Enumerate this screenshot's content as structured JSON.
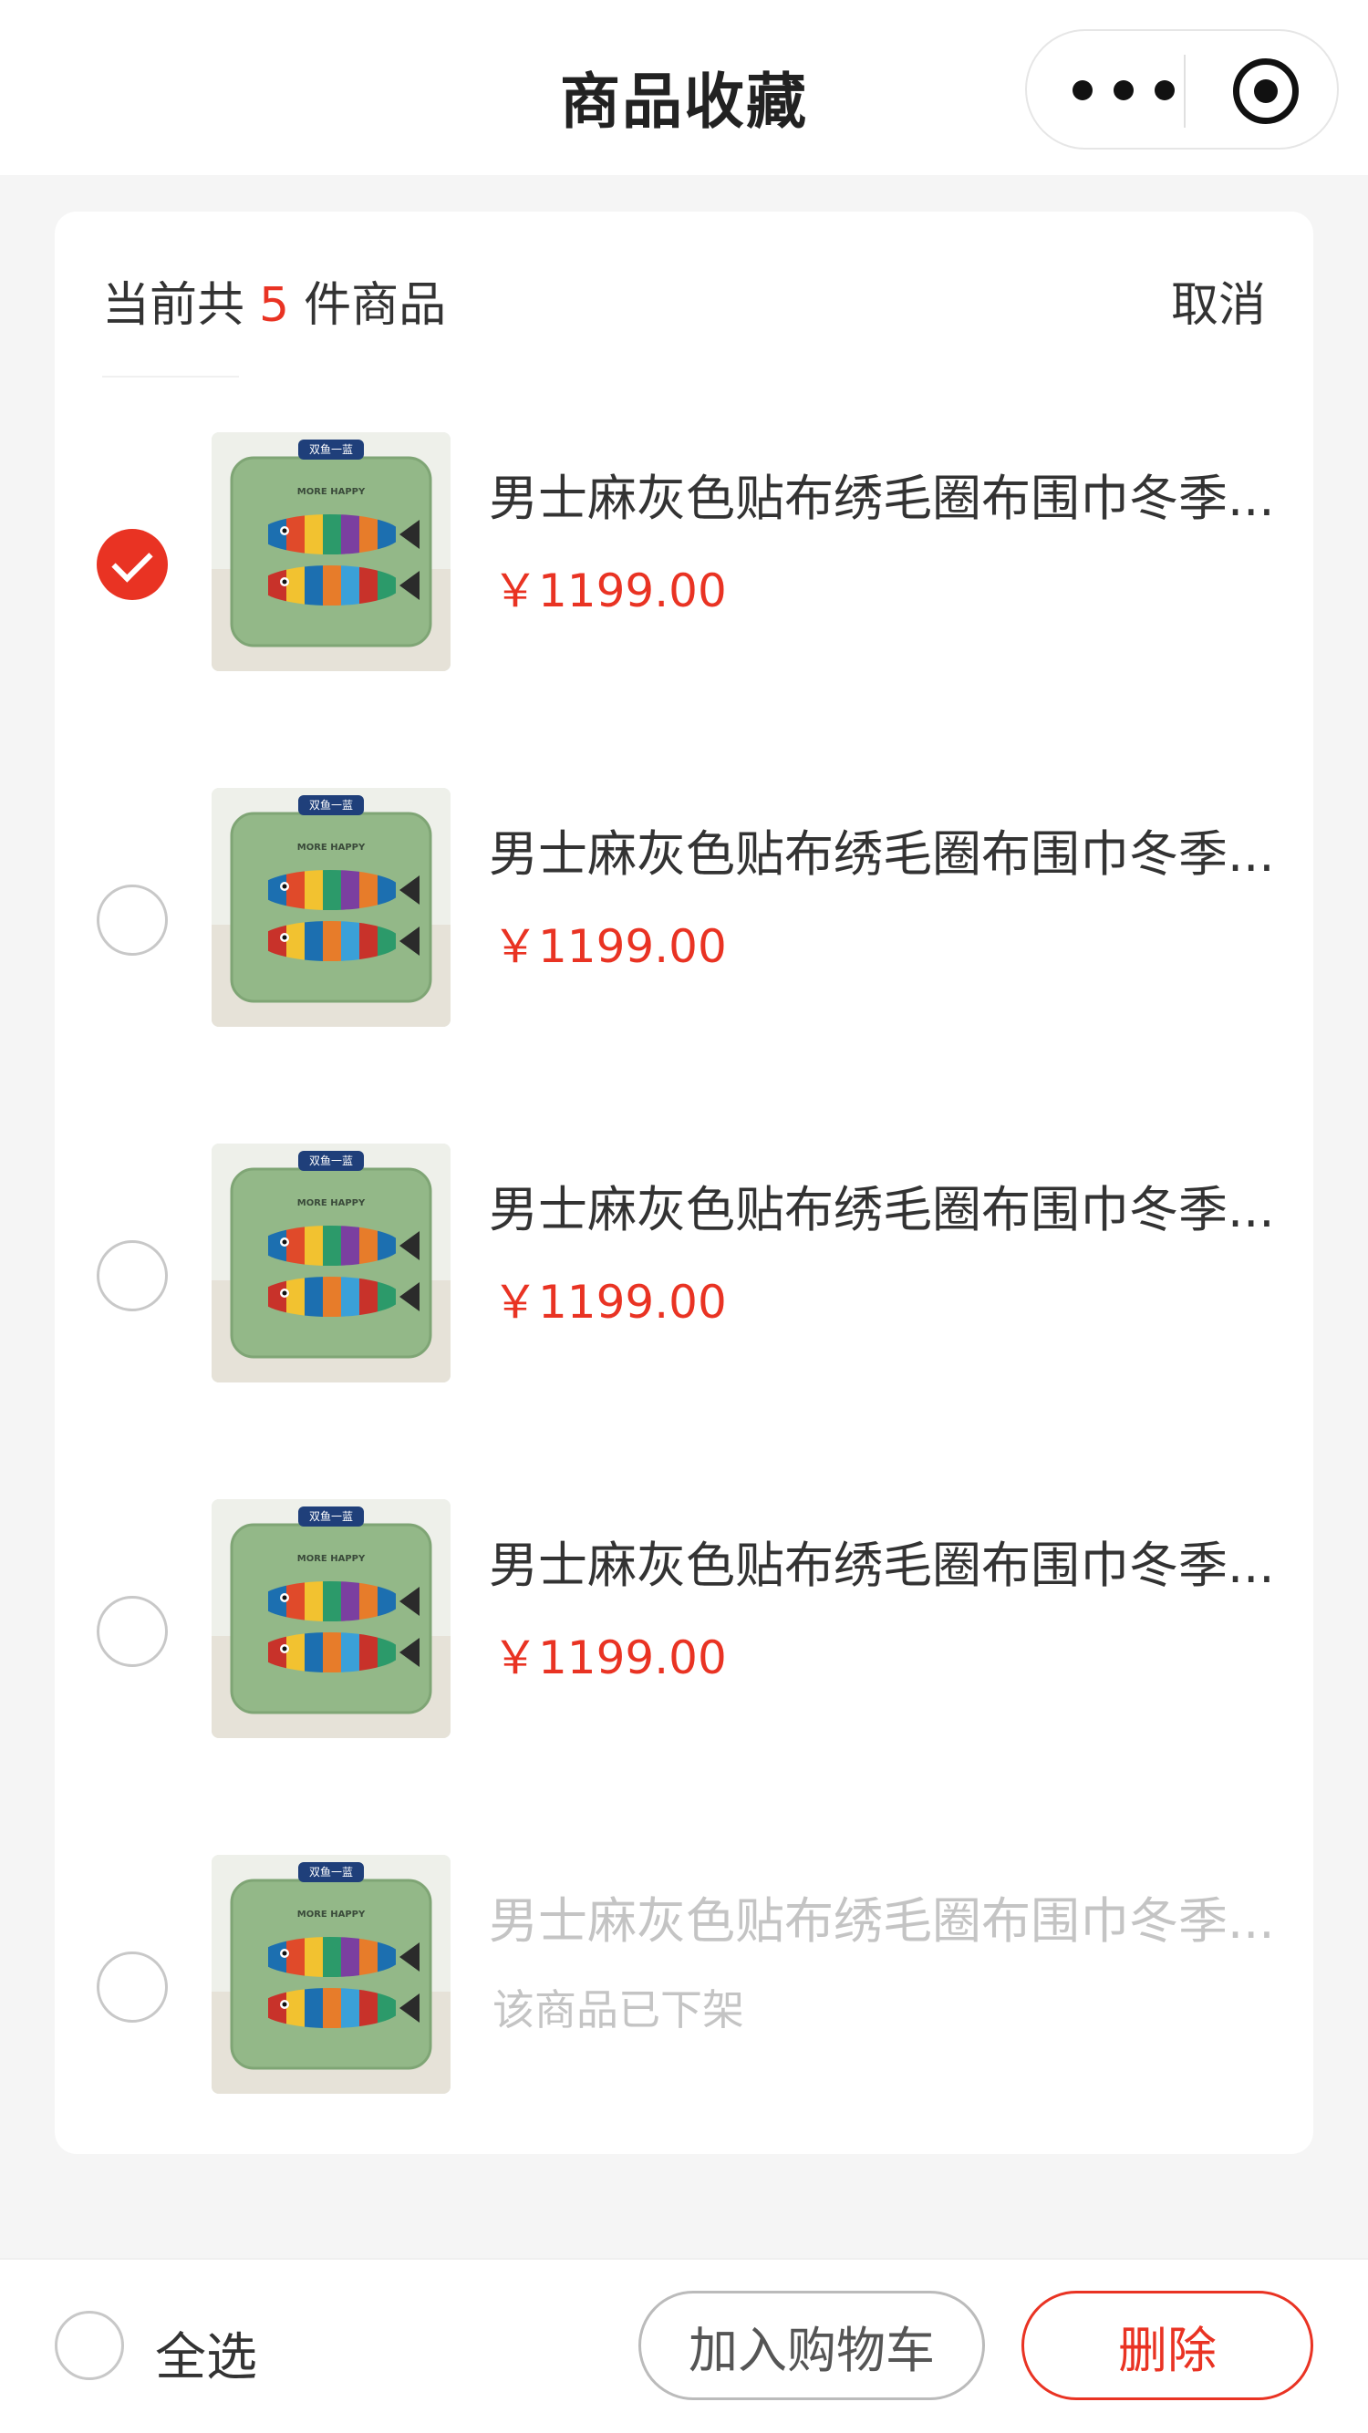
{
  "navbar": {
    "title": "商品收藏",
    "more_icon": "ellipsis-icon",
    "close_icon": "target-circle-icon"
  },
  "summary": {
    "prefix": "当前共",
    "count": "5",
    "suffix": "件商品",
    "cancel_label": "取消"
  },
  "items": [
    {
      "title": "男士麻灰色贴布绣毛圈布围巾冬季...",
      "price": "￥1199.00",
      "checked": true,
      "status": ""
    },
    {
      "title": "男士麻灰色贴布绣毛圈布围巾冬季...",
      "price": "￥1199.00",
      "checked": false,
      "status": ""
    },
    {
      "title": "男士麻灰色贴布绣毛圈布围巾冬季...",
      "price": "￥1199.00",
      "checked": false,
      "status": ""
    },
    {
      "title": "男士麻灰色贴布绣毛圈布围巾冬季...",
      "price": "￥1199.00",
      "checked": false,
      "status": ""
    },
    {
      "title": "男士麻灰色贴布绣毛圈布围巾冬季...",
      "price": "",
      "checked": false,
      "status": "该商品已下架"
    }
  ],
  "thumbnail": {
    "badge": "双鱼一蓝",
    "caption": "MORE HAPPY"
  },
  "bottom_bar": {
    "select_all_label": "全选",
    "add_to_cart_label": "加入购物车",
    "delete_label": "删除"
  },
  "colors": {
    "accent": "#e93323",
    "disabled_text": "#c4c4c4",
    "pillow_green": "#93b888"
  }
}
